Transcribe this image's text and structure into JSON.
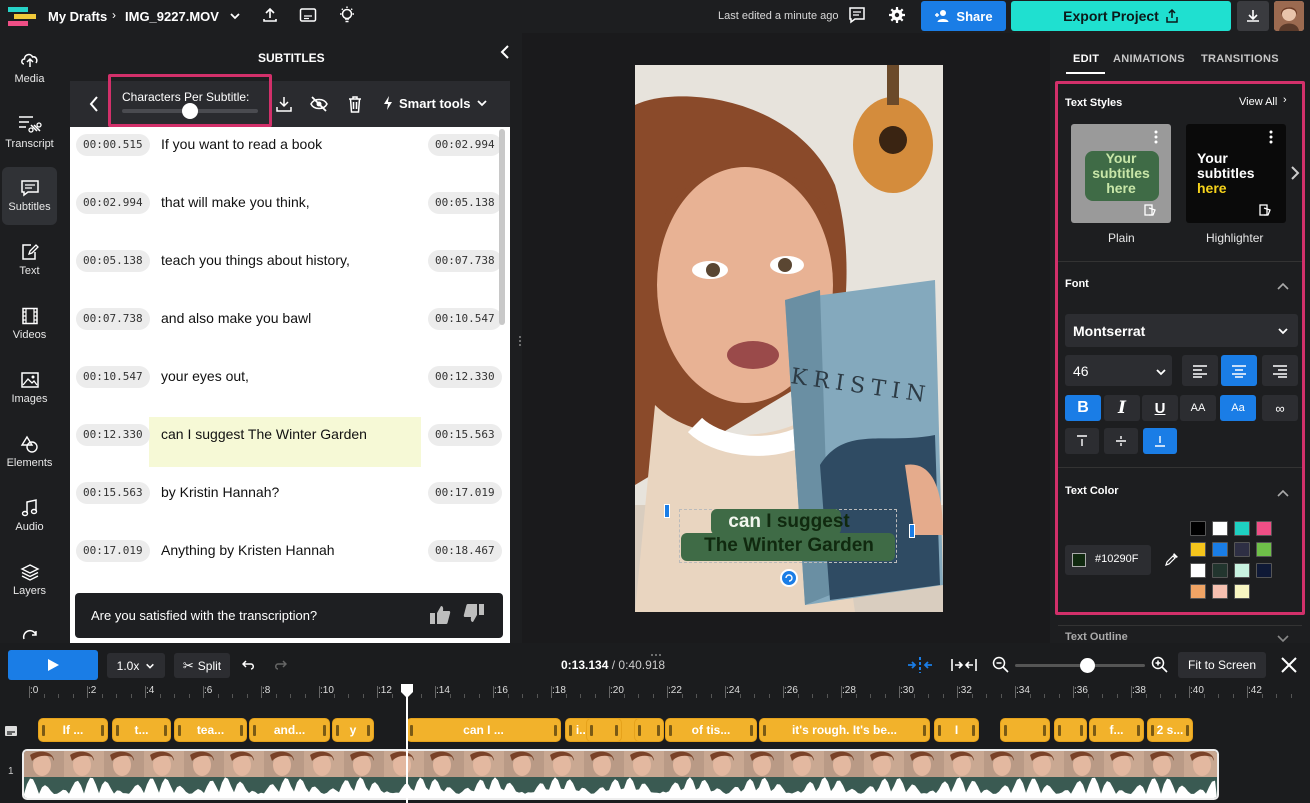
{
  "header": {
    "breadcrumb_root": "My Drafts",
    "file_name": "IMG_9227.MOV",
    "last_edited": "Last edited a minute ago",
    "share_label": "Share",
    "export_label": "Export Project"
  },
  "sidebar": {
    "items": [
      {
        "label": "Media",
        "icon": "upload-icon"
      },
      {
        "label": "Transcript",
        "icon": "transcript-icon"
      },
      {
        "label": "Subtitles",
        "icon": "subtitles-icon"
      },
      {
        "label": "Text",
        "icon": "text-edit-icon"
      },
      {
        "label": "Videos",
        "icon": "film-icon"
      },
      {
        "label": "Images",
        "icon": "image-icon"
      },
      {
        "label": "Elements",
        "icon": "shapes-icon"
      },
      {
        "label": "Audio",
        "icon": "music-icon"
      },
      {
        "label": "Layers",
        "icon": "layers-icon"
      }
    ],
    "active": "Subtitles"
  },
  "subtitles_panel": {
    "title": "SUBTITLES",
    "chars_per_subtitle_label": "Characters Per Subtitle:",
    "chars_slider_level": 0.5,
    "smart_tools_label": "Smart tools",
    "rows": [
      {
        "start": "00:00.515",
        "text": "If you want to read a book",
        "end": "00:02.994",
        "active": false
      },
      {
        "start": "00:02.994",
        "text": "that will make you think,",
        "end": "00:05.138",
        "active": false
      },
      {
        "start": "00:05.138",
        "text": "teach you things about history,",
        "end": "00:07.738",
        "active": false
      },
      {
        "start": "00:07.738",
        "text": "and also make you bawl",
        "end": "00:10.547",
        "active": false
      },
      {
        "start": "00:10.547",
        "text": "your eyes out,",
        "end": "00:12.330",
        "active": false
      },
      {
        "start": "00:12.330",
        "text": "can I suggest The Winter Garden",
        "end": "00:15.563",
        "active": true
      },
      {
        "start": "00:15.563",
        "text": "by Kristin Hannah?",
        "end": "00:17.019",
        "active": false
      },
      {
        "start": "00:17.019",
        "text": "Anything by Kristen Hannah",
        "end": "00:18.467",
        "active": false
      }
    ],
    "feedback_question": "Are you satisfied with the transcription?"
  },
  "preview": {
    "caption_line1_highlight": "can",
    "caption_line1_rest": " I suggest",
    "caption_line2": "The Winter Garden",
    "book_title_text": "KRISTIN HANNAH"
  },
  "right_panel": {
    "tabs": [
      "EDIT",
      "ANIMATIONS",
      "TRANSITIONS"
    ],
    "active_tab": "EDIT",
    "text_styles_label": "Text Styles",
    "view_all_label": "View All",
    "styles": [
      {
        "preview_lines": [
          "Your",
          "subtitles",
          "here"
        ],
        "name": "Plain"
      },
      {
        "preview_lines": [
          "Your",
          "subtitles",
          "here"
        ],
        "name": "Highlighter"
      }
    ],
    "font_label": "Font",
    "font_family": "Montserrat",
    "font_size": "46",
    "case_upper_label": "AA",
    "case_mixed_label": "Aa",
    "text_color_label": "Text Color",
    "text_color_value": "#10290F",
    "text_outline_label": "Text Outline",
    "swatches": [
      "#000000",
      "#ffffff",
      "#1fd0c1",
      "#ef4f86",
      "#f5c51c",
      "#1a7de6",
      "#2e2f44",
      "#6fbf49",
      "#ffffff",
      "#22352e",
      "#c8f2e0",
      "#0f1936",
      "#f0a465",
      "#f6c0b0",
      "#f8f6c2"
    ]
  },
  "timeline": {
    "speed": "1.0x",
    "split_label": "Split",
    "current_time": "0:13.134",
    "total_time": "0:40.918",
    "fit_label": "Fit to Screen",
    "zoom_level": 0.55,
    "ticks": [
      ":0",
      ":2",
      ":4",
      ":6",
      ":8",
      ":10",
      ":12",
      ":14",
      ":16",
      ":18",
      ":20",
      ":22",
      ":24",
      ":26",
      ":28",
      ":30",
      ":32",
      ":34",
      ":36",
      ":38",
      ":40",
      ":42"
    ],
    "clips": [
      "If ...",
      "t...",
      "tea...",
      "and...",
      "y",
      "can I ...",
      "",
      "i...",
      "",
      "of tis...",
      "it's rough. It's be...",
      "I",
      "",
      "f...",
      "2 s..."
    ],
    "video_track_number": "1"
  }
}
